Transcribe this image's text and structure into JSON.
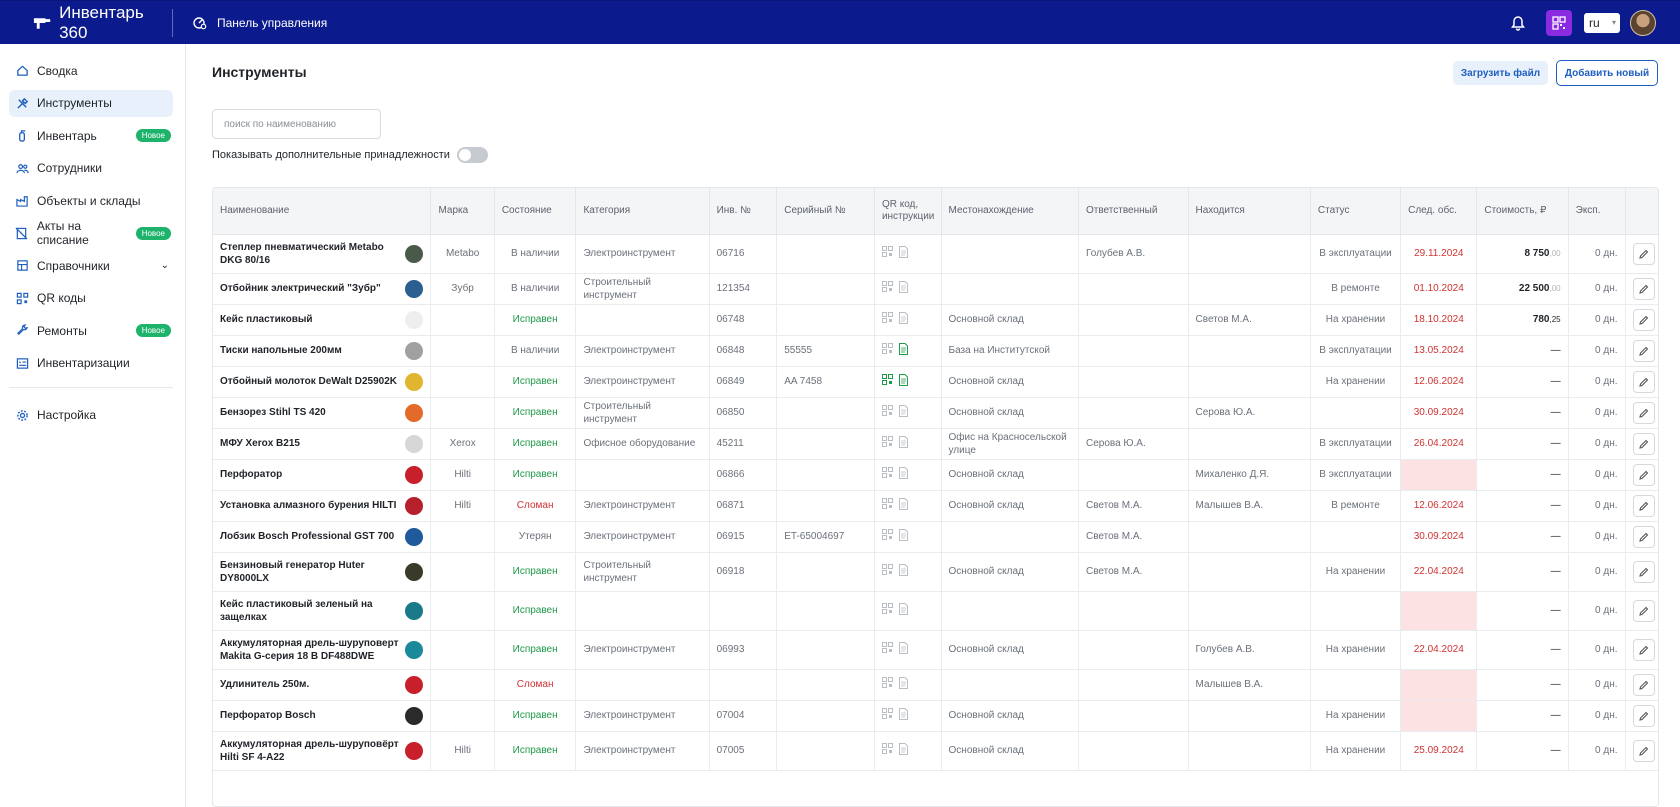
{
  "app": {
    "title": "Инвентарь 360",
    "breadcrumb": "Панель управления",
    "lang": "ru"
  },
  "sidebar": {
    "items": [
      {
        "label": "Сводка",
        "icon": "home-icon"
      },
      {
        "label": "Инструменты",
        "icon": "tools-icon",
        "active": true
      },
      {
        "label": "Инвентарь",
        "icon": "extinguisher-icon",
        "badge": "Новое"
      },
      {
        "label": "Сотрудники",
        "icon": "users-icon"
      },
      {
        "label": "Объекты и склады",
        "icon": "factory-icon"
      },
      {
        "label": "Акты на списание",
        "icon": "writeoff-icon",
        "badge": "Новое"
      },
      {
        "label": "Справочники",
        "icon": "book-icon",
        "expandable": true
      },
      {
        "label": "QR коды",
        "icon": "qr-icon"
      },
      {
        "label": "Ремонты",
        "icon": "wrench-icon",
        "badge": "Новое"
      },
      {
        "label": "Инвентаризации",
        "icon": "checklist-icon"
      }
    ],
    "settings": {
      "label": "Настройка",
      "icon": "gear-icon"
    }
  },
  "main": {
    "title": "Инструменты",
    "upload_label": "Загрузить файл",
    "add_label": "Добавить новый",
    "search_placeholder": "поиск по наименованию",
    "toggle_label": "Показывать дополнительные принадлежности",
    "toggle_on": false
  },
  "table": {
    "columns": [
      "Наименование",
      "Марка",
      "Состояние",
      "Категория",
      "Инв. №",
      "Серийный №",
      "QR код, инструкции",
      "Местонахождение",
      "Ответственный",
      "Находится",
      "Статус",
      "След. обс.",
      "Стоимость, ₽",
      "Эксп."
    ],
    "rows": [
      {
        "name": "Степлер пневматический Metabo DKG 80/16",
        "brand": "Metabo",
        "state": "В наличии",
        "state_kind": "neutral",
        "category": "Электроинструмент",
        "inv": "06716",
        "serial": "",
        "qr_active": false,
        "location": "",
        "responsible": "Голубев А.В.",
        "holder": "",
        "status": "В эксплуатации",
        "next": "29.11.2024",
        "cost_int": "8 750",
        "cost_dec": ",00",
        "exp": "0 дн.",
        "thumb": "#4a5a4a"
      },
      {
        "name": "Отбойник электрический \"Зубр\"",
        "brand": "Зубр",
        "state": "В наличии",
        "state_kind": "neutral",
        "category": "Строительный инструмент",
        "inv": "121354",
        "serial": "",
        "qr_active": false,
        "location": "",
        "responsible": "",
        "holder": "",
        "status": "В ремонте",
        "next": "01.10.2024",
        "cost_int": "22 500",
        "cost_dec": ",00",
        "exp": "0 дн.",
        "thumb": "#2b5f8f"
      },
      {
        "name": "Кейс пластиковый",
        "brand": "",
        "state": "Исправен",
        "state_kind": "ok",
        "category": "",
        "inv": "06748",
        "serial": "",
        "qr_active": false,
        "location": "Основной склад",
        "responsible": "",
        "holder": "Светов М.А.",
        "status": "На хранении",
        "next": "18.10.2024",
        "cost_int": "780",
        "cost_dec": ",25",
        "exp": "0 дн.",
        "thumb": "#eeeeee"
      },
      {
        "name": "Тиски напольные 200мм",
        "brand": "",
        "state": "В наличии",
        "state_kind": "neutral",
        "category": "Электроинструмент",
        "inv": "06848",
        "serial": "55555",
        "qr_active": false,
        "doc_active": true,
        "location": "База на Институтской",
        "responsible": "",
        "holder": "",
        "status": "В эксплуатации",
        "next": "13.05.2024",
        "cost_int": "",
        "cost_dec": "",
        "exp": "0 дн.",
        "thumb": "#a0a0a0"
      },
      {
        "name": "Отбойный молоток DeWalt D25902K",
        "brand": "",
        "state": "Исправен",
        "state_kind": "ok",
        "category": "Электроинструмент",
        "inv": "06849",
        "serial": "AA 7458",
        "qr_active": true,
        "doc_active": true,
        "location": "Основной склад",
        "responsible": "",
        "holder": "",
        "status": "На хранении",
        "next": "12.06.2024",
        "cost_int": "",
        "cost_dec": "",
        "exp": "0 дн.",
        "thumb": "#e2b531"
      },
      {
        "name": "Бензорез Stihl TS 420",
        "brand": "",
        "state": "Исправен",
        "state_kind": "ok",
        "category": "Строительный инструмент",
        "inv": "06850",
        "serial": "",
        "qr_active": false,
        "location": "Основной склад",
        "responsible": "",
        "holder": "Серова Ю.А.",
        "status": "",
        "next": "30.09.2024",
        "cost_int": "",
        "cost_dec": "",
        "exp": "0 дн.",
        "thumb": "#e46a2a"
      },
      {
        "name": "МФУ Xerox B215",
        "brand": "Xerox",
        "state": "Исправен",
        "state_kind": "ok",
        "category": "Офисное оборудование",
        "inv": "45211",
        "serial": "",
        "qr_active": false,
        "location": "Офис на Красносельской улице",
        "responsible": "Серова Ю.А.",
        "holder": "",
        "status": "В эксплуатации",
        "next": "26.04.2024",
        "cost_int": "",
        "cost_dec": "",
        "exp": "0 дн.",
        "thumb": "#d7d7d7"
      },
      {
        "name": "Перфоратор",
        "brand": "Hilti",
        "state": "Исправен",
        "state_kind": "ok",
        "category": "",
        "inv": "06866",
        "serial": "",
        "qr_active": false,
        "location": "Основной склад",
        "responsible": "",
        "holder": "Михаленко Д.Я.",
        "status": "В эксплуатации",
        "next": "",
        "cost_int": "",
        "cost_dec": "",
        "exp": "0 дн.",
        "thumb": "#c8202a"
      },
      {
        "name": "Установка алмазного бурения HILTI",
        "brand": "Hilti",
        "state": "Сломан",
        "state_kind": "broken",
        "category": "Электроинструмент",
        "inv": "06871",
        "serial": "",
        "qr_active": false,
        "location": "Основной склад",
        "responsible": "Светов М.А.",
        "holder": "Малышев В.А.",
        "status": "В ремонте",
        "next": "12.06.2024",
        "cost_int": "",
        "cost_dec": "",
        "exp": "0 дн.",
        "thumb": "#b5202a"
      },
      {
        "name": "Лобзик Bosch Professional GST 700",
        "brand": "",
        "state": "Утерян",
        "state_kind": "neutral",
        "category": "Электроинструмент",
        "inv": "06915",
        "serial": "ET-65004697",
        "qr_active": false,
        "location": "",
        "responsible": "Светов М.А.",
        "holder": "",
        "status": "",
        "next": "30.09.2024",
        "cost_int": "",
        "cost_dec": "",
        "exp": "0 дн.",
        "thumb": "#1f5a9a"
      },
      {
        "name": "Бензиновый генератор Huter DY8000LX",
        "brand": "",
        "state": "Исправен",
        "state_kind": "ok",
        "category": "Строительный инструмент",
        "inv": "06918",
        "serial": "",
        "qr_active": false,
        "location": "Основной склад",
        "responsible": "Светов М.А.",
        "holder": "",
        "status": "На хранении",
        "next": "22.04.2024",
        "cost_int": "",
        "cost_dec": "",
        "exp": "0 дн.",
        "thumb": "#3a3a2a"
      },
      {
        "name": "Кейс пластиковый зеленый на защелках",
        "brand": "",
        "state": "Исправен",
        "state_kind": "ok",
        "category": "",
        "inv": "",
        "serial": "",
        "qr_active": false,
        "location": "",
        "responsible": "",
        "holder": "",
        "status": "",
        "next": "",
        "cost_int": "",
        "cost_dec": "",
        "exp": "0 дн.",
        "thumb": "#1a7a8a"
      },
      {
        "name": "Аккумуляторная дрель-шуруповерт Makita G-серия 18 В DF488DWE",
        "brand": "",
        "state": "Исправен",
        "state_kind": "ok",
        "category": "Электроинструмент",
        "inv": "06993",
        "serial": "",
        "qr_active": false,
        "location": "Основной склад",
        "responsible": "",
        "holder": "Голубев А.В.",
        "status": "На хранении",
        "next": "22.04.2024",
        "cost_int": "",
        "cost_dec": "",
        "exp": "0 дн.",
        "thumb": "#1a8a9a"
      },
      {
        "name": "Удлинитель 250м.",
        "brand": "",
        "state": "Сломан",
        "state_kind": "broken",
        "category": "",
        "inv": "",
        "serial": "",
        "qr_active": false,
        "location": "",
        "responsible": "",
        "holder": "Малышев В.А.",
        "status": "",
        "next": "",
        "cost_int": "",
        "cost_dec": "",
        "exp": "0 дн.",
        "thumb": "#c8202a"
      },
      {
        "name": "Перфоратор Bosch",
        "brand": "",
        "state": "Исправен",
        "state_kind": "ok",
        "category": "Электроинструмент",
        "inv": "07004",
        "serial": "",
        "qr_active": false,
        "location": "Основной склад",
        "responsible": "",
        "holder": "",
        "status": "На хранении",
        "next": "",
        "cost_int": "",
        "cost_dec": "",
        "exp": "0 дн.",
        "thumb": "#2a2a2a"
      },
      {
        "name": "Аккумуляторная дрель-шуруповёрт Hilti SF 4-A22",
        "brand": "Hilti",
        "state": "Исправен",
        "state_kind": "ok",
        "category": "Электроинструмент",
        "inv": "07005",
        "serial": "",
        "qr_active": false,
        "location": "Основной склад",
        "responsible": "",
        "holder": "",
        "status": "На хранении",
        "next": "25.09.2024",
        "cost_int": "",
        "cost_dec": "",
        "exp": "0 дн.",
        "thumb": "#c8202a"
      }
    ],
    "dash": "—"
  }
}
